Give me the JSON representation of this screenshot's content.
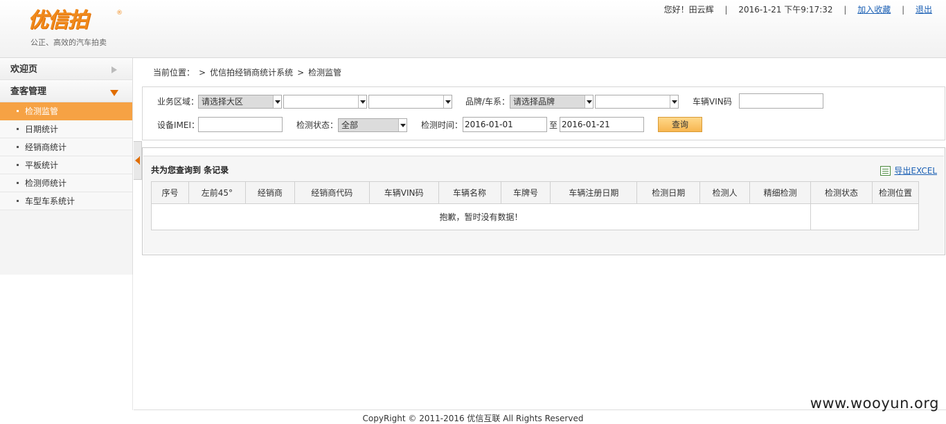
{
  "header": {
    "logo_text": "优信拍",
    "logo_reg": "®",
    "slogan": "公正、高效的汽车拍卖",
    "greeting": "您好！田云辉",
    "datetime": "2016-1-21 下午9:17:32",
    "sep": "|",
    "favorite_link": "加入收藏",
    "logout_link": "退出"
  },
  "sidebar": {
    "welcome": "欢迎页",
    "section": "查客管理",
    "items": [
      {
        "label": "检测监管"
      },
      {
        "label": "日期统计"
      },
      {
        "label": "经销商统计"
      },
      {
        "label": "平板统计"
      },
      {
        "label": "检测师统计"
      },
      {
        "label": "车型车系统计"
      }
    ]
  },
  "breadcrumb": {
    "prefix": "当前位置：",
    "gt": ">",
    "system": "优信拍经销商统计系统",
    "page": "检测监管"
  },
  "search": {
    "region_label": "业务区域：",
    "region_value": "请选择大区",
    "brand_label": "品牌/车系：",
    "brand_value": "请选择品牌",
    "vin_label": "车辆VIN码",
    "imei_label": "设备IMEI：",
    "status_label": "检测状态：",
    "status_value": "全部",
    "time_label": "检测时间：",
    "date_from": "2016-01-01",
    "to_label": "至",
    "date_to": "2016-01-21",
    "query_button": "查询"
  },
  "result": {
    "title": "共为您查询到  条记录",
    "export_label": "导出EXCEL",
    "columns": [
      "序号",
      "左前45°",
      "经销商",
      "经销商代码",
      "车辆VIN码",
      "车辆名称",
      "车牌号",
      "车辆注册日期",
      "检测日期",
      "检测人",
      "精细检测",
      "检测状态",
      "检测位置"
    ],
    "empty_message": "抱歉，暂时没有数据！"
  },
  "footer": {
    "copyright": "CopyRight © 2011-2016 优信互联 All Rights Reserved",
    "watermark": "www.wooyun.org"
  },
  "colors": {
    "brand_orange": "#f08a1c",
    "active_menu": "#f6a244",
    "link_blue": "#1a5fb4"
  }
}
